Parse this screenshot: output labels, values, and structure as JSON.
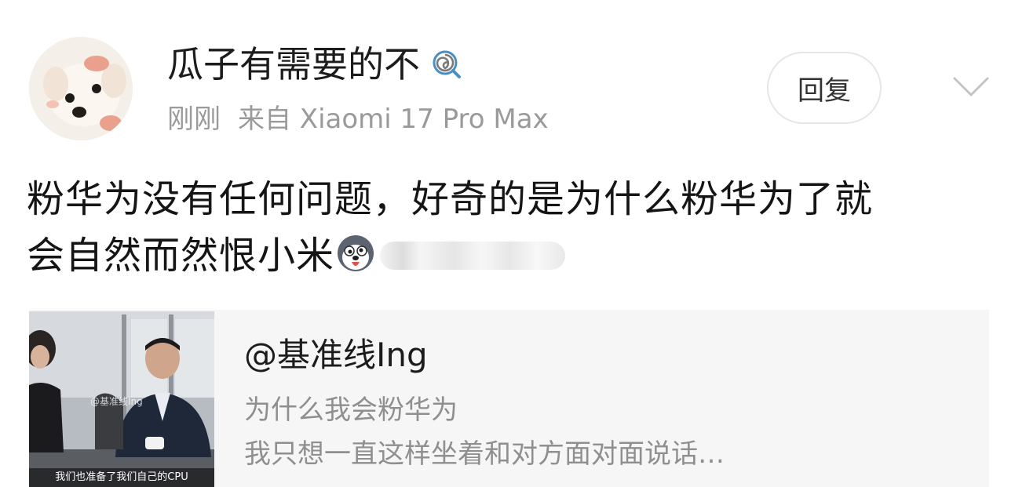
{
  "post": {
    "username": "瓜子有需要的不",
    "time": "刚刚",
    "source": "来自 Xiaomi 17 Pro Max",
    "reply_label": "回复",
    "text_line1": "粉华为没有任何问题，好奇的是为什么粉华为了就",
    "text_line2": "会自然而然恨小米"
  },
  "repost": {
    "author": "@基准线Ing",
    "line1": "为什么我会粉华为",
    "line2": "我只想一直这样坐着和对方面对面说话…",
    "thumbnail_caption": "我们也准备了我们自己的CPU",
    "thumbnail_watermark": "@基准线Ing"
  },
  "colors": {
    "background": "#ffffff",
    "secondary_text": "#9a9a9a",
    "card_background": "#f6f6f6",
    "badge_accent": "#4a8fc4"
  },
  "icons": {
    "badge": "member-badge-icon",
    "chevron": "chevron-down-icon",
    "emoji": "husky-emoji-icon"
  }
}
